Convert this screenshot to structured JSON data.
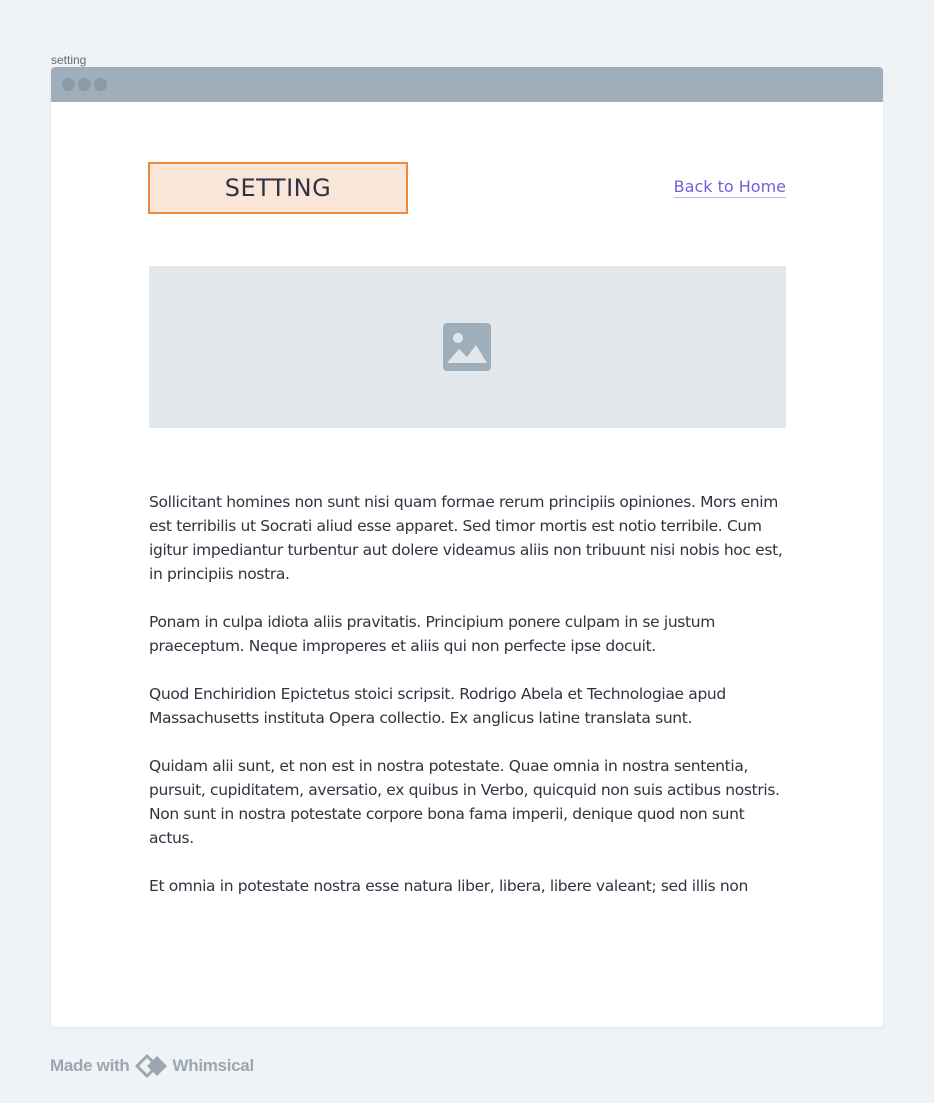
{
  "frame": {
    "label": "setting"
  },
  "header": {
    "title": "SETTING",
    "back_link": "Back to Home"
  },
  "hero": {
    "icon": "image-icon"
  },
  "content": {
    "paragraphs": [
      "Sollicitant homines non sunt nisi quam formae rerum principiis opiniones. Mors enim est terribilis ut Socrati aliud esse apparet. Sed timor mortis est notio terribile. Cum igitur impediantur turbentur aut dolere videamus aliis non tribuunt nisi nobis hoc est, in principiis nostra.",
      "Ponam in culpa idiota aliis pravitatis. Principium ponere culpam in se justum praeceptum. Neque improperes et aliis qui non perfecte ipse docuit.",
      "Quod Enchiridion Epictetus stoici scripsit. Rodrigo Abela et Technologiae apud Massachusetts instituta Opera collectio. Ex anglicus latine translata sunt.",
      "Quidam alii sunt, et non est in nostra potestate. Quae omnia in nostra sententia, pursuit, cupiditatem, aversatio, ex quibus in Verbo, quicquid non suis actibus nostris. Non sunt in nostra potestate corpore bona fama imperii, denique quod non sunt actus.",
      "Et omnia in potestate nostra esse natura liber, libera, libere valeant; sed illis non"
    ]
  },
  "footer": {
    "made_with": "Made with",
    "brand": "Whimsical"
  },
  "colors": {
    "accent_border": "#f0893c",
    "accent_fill": "#fae5d9",
    "link": "#6b63d9",
    "titlebar": "#9eaeba"
  }
}
